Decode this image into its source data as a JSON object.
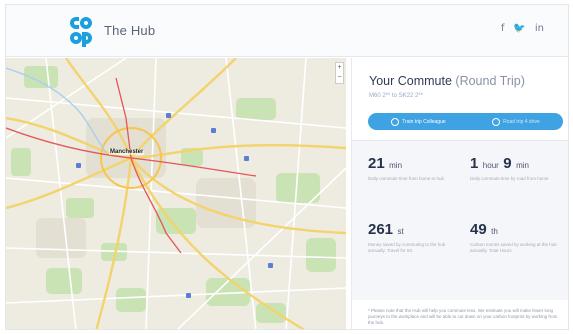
{
  "header": {
    "brand": "The Hub",
    "social": {
      "facebook": "f",
      "twitter": "🐦",
      "linkedin": "in"
    },
    "logo_colors": [
      "#1aa0dd"
    ]
  },
  "map": {
    "city_label": "Manchester",
    "zoom_in": "+",
    "zoom_out": "−"
  },
  "panel": {
    "title": "Your Commute",
    "title_suffix": "(Round Trip)",
    "route": "M60 2** to SK22 2**",
    "toggle": [
      {
        "label": "Train trip Colleague",
        "icon": "circle-icon",
        "active": true
      },
      {
        "label": "Road trip 4 drive",
        "icon": "circle-icon",
        "active": false
      }
    ],
    "stats": [
      {
        "value": "21",
        "unit": "min",
        "desc": "Daily commute time from home to hub"
      },
      {
        "value": "1",
        "unit": "hour",
        "value2": "9",
        "unit2": "min",
        "desc": "Daily commute time by road from home"
      },
      {
        "value": "261",
        "unit": "st",
        "desc": "Money saved by commuting to the hub annually. Travel for 50."
      },
      {
        "value": "49",
        "unit": "th",
        "desc": "Carbon tonnes saved by working at the hub annually. Total Hours"
      }
    ],
    "footnote": "* Please note that the Hub will help you commute less. We estimate you will make fewer long journeys to the workplace and will be able to cut down on your carbon footprint by working from the hub."
  },
  "colors": {
    "accent": "#3fa2e3",
    "text": "#2f3b55"
  }
}
